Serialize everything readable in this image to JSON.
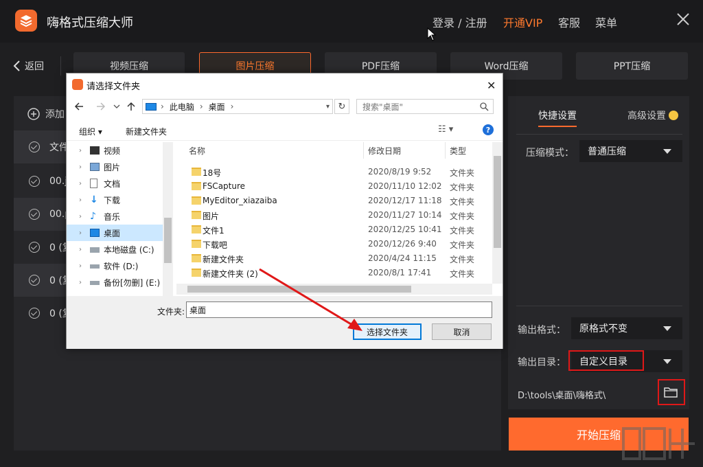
{
  "app": {
    "title": "嗨格式压缩大师"
  },
  "topnav": {
    "login": "登录 / 注册",
    "vip": "开通VIP",
    "service": "客服",
    "menu": "菜单"
  },
  "back_label": "返回",
  "tabs": [
    {
      "label": "视频压缩"
    },
    {
      "label": "图片压缩"
    },
    {
      "label": "PDF压缩"
    },
    {
      "label": "Word压缩"
    },
    {
      "label": "PPT压缩"
    }
  ],
  "left": {
    "add_label": "添加",
    "rows": [
      "文件",
      "00.j",
      "00.p",
      "0 (复",
      "0 (复",
      "0 (复"
    ]
  },
  "settings": {
    "tab_quick": "快捷设置",
    "tab_advanced": "高级设置",
    "mode_label": "压缩模式：",
    "mode_value": "普通压缩",
    "format_label": "输出格式：",
    "format_value": "原格式不变",
    "dir_label": "输出目录：",
    "dir_value": "自定义目录",
    "path": "D:\\tools\\桌面\\嗨格式\\",
    "start_label": "开始压缩"
  },
  "dialog": {
    "title": "请选择文件夹",
    "address": [
      "此电脑",
      "桌面"
    ],
    "search_placeholder": "搜索\"桌面\"",
    "toolbar": {
      "organize": "组织 ▾",
      "new_folder": "新建文件夹"
    },
    "tree": [
      {
        "label": "视频",
        "icon": "video-icon"
      },
      {
        "label": "图片",
        "icon": "picture-icon"
      },
      {
        "label": "文档",
        "icon": "document-icon"
      },
      {
        "label": "下载",
        "icon": "download-icon"
      },
      {
        "label": "音乐",
        "icon": "music-icon"
      },
      {
        "label": "桌面",
        "icon": "desktop-icon",
        "selected": true
      },
      {
        "label": "本地磁盘 (C:)",
        "icon": "drive-icon"
      },
      {
        "label": "软件 (D:)",
        "icon": "drive-icon"
      },
      {
        "label": "备份[勿删] (E:)",
        "icon": "drive-icon"
      }
    ],
    "columns": {
      "name": "名称",
      "date": "修改日期",
      "type": "类型"
    },
    "files": [
      {
        "name": "18号",
        "date": "2020/8/19 9:52",
        "type": "文件夹"
      },
      {
        "name": "FSCapture",
        "date": "2020/11/10 12:02",
        "type": "文件夹"
      },
      {
        "name": "MyEditor_xiazaiba",
        "date": "2020/12/17 11:18",
        "type": "文件夹"
      },
      {
        "name": "图片",
        "date": "2020/11/27 10:14",
        "type": "文件夹"
      },
      {
        "name": "文件1",
        "date": "2020/12/25 10:41",
        "type": "文件夹"
      },
      {
        "name": "下载吧",
        "date": "2020/12/26 9:40",
        "type": "文件夹"
      },
      {
        "name": "新建文件夹",
        "date": "2020/4/24 11:15",
        "type": "文件夹"
      },
      {
        "name": "新建文件夹 (2)",
        "date": "2020/8/1 17:41",
        "type": "文件夹"
      }
    ],
    "folder_label": "文件夹:",
    "folder_value": "桌面",
    "select_button": "选择文件夹",
    "cancel_button": "取消"
  },
  "colors": {
    "accent": "#ff6a2e",
    "highlight": "#e01818",
    "background": "#1f1f21"
  }
}
